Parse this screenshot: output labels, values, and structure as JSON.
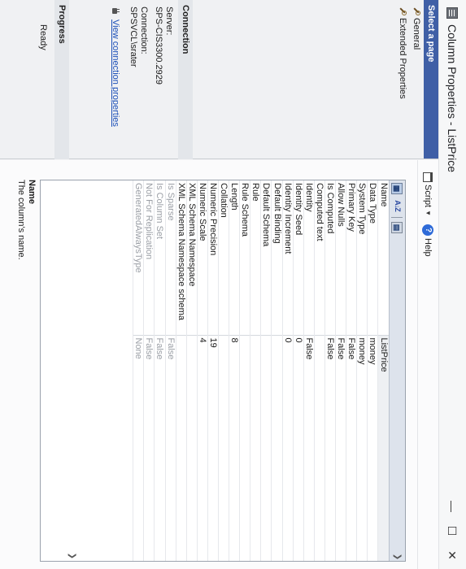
{
  "window": {
    "title": "Column Properties - ListPrice",
    "minimize_glyph": "—",
    "maximize_glyph": "☐",
    "close_glyph": "✕"
  },
  "left": {
    "select_page": "Select a page",
    "pages": [
      {
        "label": "General",
        "icon": "wrench-icon"
      },
      {
        "label": "Extended Properties",
        "icon": "wrench-icon"
      }
    ],
    "connection": {
      "heading": "Connection",
      "server_label": "Server:",
      "server_value": "SPS-CIS3300.2929",
      "connection_label": "Connection:",
      "connection_value": "SPSVCL\\srater",
      "link": "View connection properties"
    },
    "progress": {
      "heading": "Progress",
      "status": "Ready"
    }
  },
  "toolbar": {
    "script": "Script",
    "help": "Help"
  },
  "grid": {
    "tools": {
      "categorized": "▦",
      "alpha": "A↓Z",
      "pages": "▤"
    },
    "rows": [
      {
        "name": "Name",
        "value": "ListPrice",
        "dim": false
      },
      {
        "name": "Data Type",
        "value": "money",
        "dim": false
      },
      {
        "name": "System Type",
        "value": "money",
        "dim": false
      },
      {
        "name": "Primary Key",
        "value": "False",
        "dim": false
      },
      {
        "name": "Allow Nulls",
        "value": "False",
        "dim": false
      },
      {
        "name": "Is Computed",
        "value": "False",
        "dim": false
      },
      {
        "name": "Computed text",
        "value": "",
        "dim": false
      },
      {
        "name": "Identity",
        "value": "False",
        "dim": false
      },
      {
        "name": "Identity Seed",
        "value": "0",
        "dim": false
      },
      {
        "name": "Identity Increment",
        "value": "0",
        "dim": false
      },
      {
        "name": "Default Binding",
        "value": "",
        "dim": false
      },
      {
        "name": "Default Schema",
        "value": "",
        "dim": false
      },
      {
        "name": "Rule",
        "value": "",
        "dim": false
      },
      {
        "name": "Rule Schema",
        "value": "",
        "dim": false
      },
      {
        "name": "Length",
        "value": "8",
        "dim": false
      },
      {
        "name": "Collation",
        "value": "",
        "dim": false
      },
      {
        "name": "Numeric Precision",
        "value": "19",
        "dim": false
      },
      {
        "name": "Numeric Scale",
        "value": "4",
        "dim": false
      },
      {
        "name": "XML Schema Namespace",
        "value": "",
        "dim": false
      },
      {
        "name": "XML Schema Namespace schema",
        "value": "",
        "dim": false
      },
      {
        "name": "Is Sparse",
        "value": "False",
        "dim": true
      },
      {
        "name": "Is Column Set",
        "value": "False",
        "dim": true
      },
      {
        "name": "Not For Replication",
        "value": "False",
        "dim": true
      },
      {
        "name": "GeneratedAlwaysType",
        "value": "None",
        "dim": true
      }
    ]
  },
  "description": {
    "name": "Name",
    "text": "The column's name."
  }
}
